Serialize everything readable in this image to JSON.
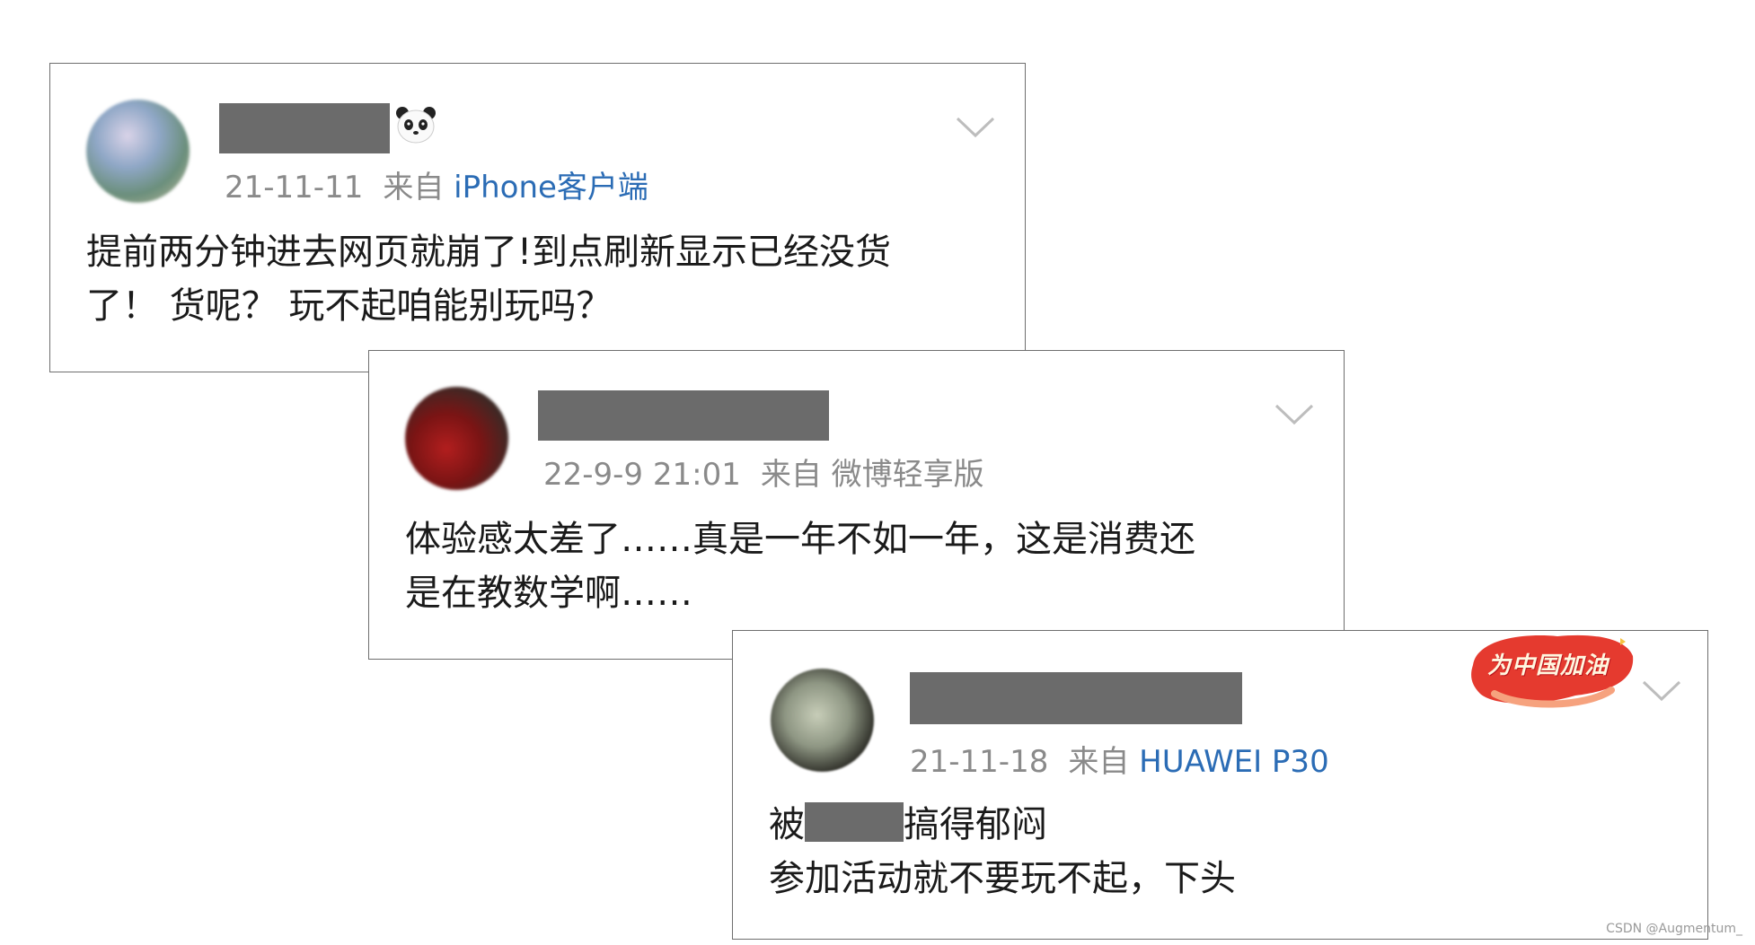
{
  "comments": [
    {
      "date": "21-11-11",
      "from_label": "来自",
      "source": "iPhone客户端",
      "text_line1": "提前两分钟进去网页就崩了!到点刷新显示已经没货",
      "text_line2": "了！ 货呢？ 玩不起咱能别玩吗？"
    },
    {
      "date": "22-9-9 21:01",
      "from_label": "来自",
      "source": "微博轻享版",
      "text_line1": "体验感太差了……真是一年不如一年，这是消费还",
      "text_line2": "是在教数学啊……"
    },
    {
      "date": "21-11-18",
      "from_label": "来自",
      "source": "HUAWEI P30",
      "text_line1_before": "被",
      "text_line1_after": "搞得郁闷",
      "text_line2": "参加活动就不要玩不起，下头",
      "badge": "为中国加油"
    }
  ],
  "watermark": "CSDN @Augmentum_",
  "colors": {
    "link": "#2b6cb5",
    "meta": "#8a8a8a",
    "redaction": "#6b6b6b",
    "badge_red": "#e53a2f"
  },
  "icons": [
    "panda-emoji-icon",
    "chevron-down-icon"
  ]
}
